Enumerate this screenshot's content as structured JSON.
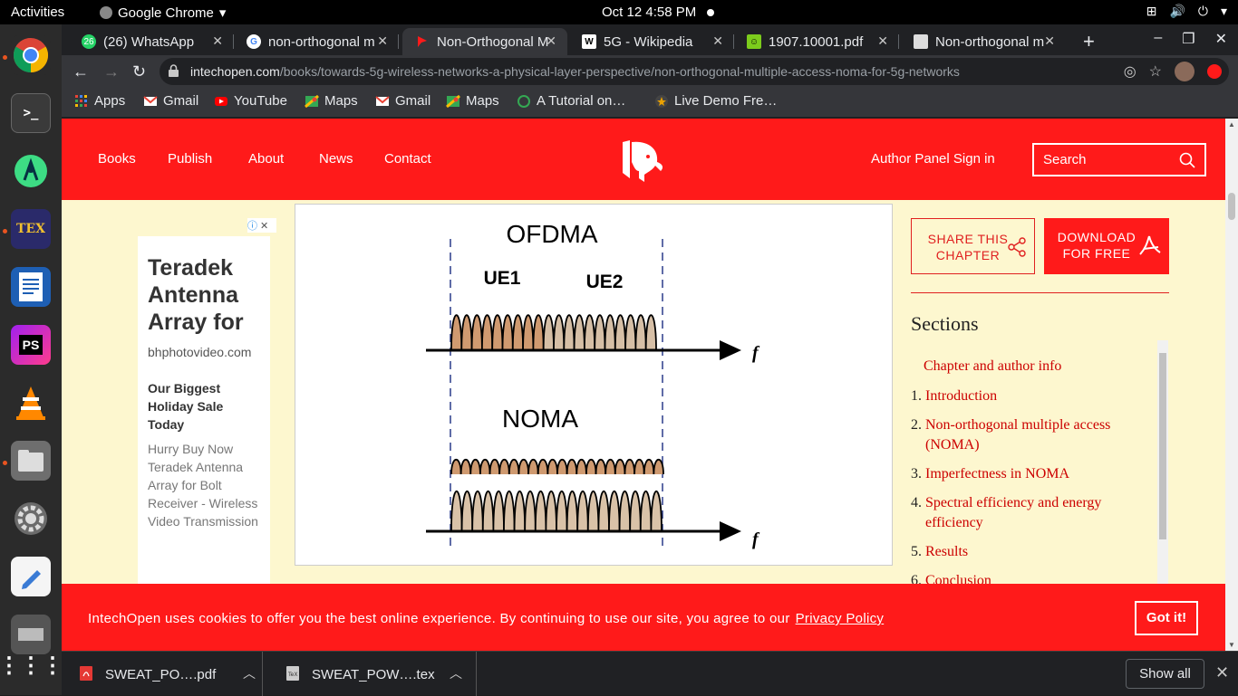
{
  "system": {
    "activities": "Activities",
    "app_name": "Google Chrome",
    "clock": "Oct 12  4:58 PM"
  },
  "tabs": [
    {
      "title": "(26) WhatsApp",
      "badge": "26",
      "favicon": "whatsapp-icon",
      "color": "#25d366"
    },
    {
      "title": "non-orthogonal m",
      "favicon": "google-icon",
      "color": "#4285f4"
    },
    {
      "title": "Non-Orthogonal M",
      "favicon": "intechopen-icon",
      "color": "#ff1a1a",
      "active": true
    },
    {
      "title": "5G - Wikipedia",
      "favicon": "wikipedia-icon",
      "color": "#ffffff"
    },
    {
      "title": "1907.10001.pdf",
      "favicon": "pdf-smile-icon",
      "color": "#7ccc1c"
    },
    {
      "title": "Non-orthogonal m",
      "favicon": "doc-icon",
      "color": "#dddddd"
    }
  ],
  "toolbar": {
    "url_host": "intechopen.com",
    "url_path": "/books/towards-5g-wireless-networks-a-physical-layer-perspective/non-orthogonal-multiple-access-noma-for-5g-networks"
  },
  "bookmarks": [
    {
      "label": "Apps",
      "icon": "apps-grid-icon"
    },
    {
      "label": "Gmail",
      "icon": "gmail-icon"
    },
    {
      "label": "YouTube",
      "icon": "youtube-icon"
    },
    {
      "label": "Maps",
      "icon": "maps-icon"
    },
    {
      "label": "Gmail",
      "icon": "gmail-icon"
    },
    {
      "label": "Maps",
      "icon": "maps-icon"
    },
    {
      "label": "A Tutorial on…",
      "icon": "tutorial-icon"
    },
    {
      "label": "Live Demo Fre…",
      "icon": "star-icon"
    }
  ],
  "site_nav": {
    "links": [
      "Books",
      "Publish",
      "About",
      "News",
      "Contact"
    ],
    "author_panel": "Author Panel Sign in",
    "search_placeholder": "Search"
  },
  "ad": {
    "headline": "Teradek Antenna Array for",
    "domain": "bhphotovideo.com",
    "subhead": "Our Biggest Holiday Sale Today",
    "description": "Hurry Buy Now Teradek Antenna Array for Bolt Receiver - Wireless Video Transmission"
  },
  "figure": {
    "top_label": "OFDMA",
    "ue1": "UE1",
    "ue2": "UE2",
    "bottom_label": "NOMA",
    "axis_label": "f"
  },
  "sidebar": {
    "share": "SHARE THIS CHAPTER",
    "download": "DOWNLOAD FOR FREE",
    "sections_title": "Sections",
    "sections": [
      {
        "num": "",
        "title": "Chapter and author info"
      },
      {
        "num": "1.",
        "title": "Introduction"
      },
      {
        "num": "2.",
        "title": "Non-orthogonal multiple access (NOMA)"
      },
      {
        "num": "3.",
        "title": "Imperfectness in NOMA"
      },
      {
        "num": "4.",
        "title": "Spectral efficiency and energy efficiency"
      },
      {
        "num": "5.",
        "title": "Results"
      },
      {
        "num": "6.",
        "title": "Conclusion"
      }
    ]
  },
  "cookie": {
    "message": "IntechOpen uses cookies to offer you the best online experience. By continuing to use our site, you agree to our",
    "link": "Privacy Policy",
    "button": "Got it!"
  },
  "downloads": {
    "items": [
      {
        "name": "SWEAT_PO….pdf",
        "icon": "pdf-file-icon"
      },
      {
        "name": "SWEAT_POW….tex",
        "icon": "tex-file-icon"
      }
    ],
    "show_all": "Show all"
  }
}
